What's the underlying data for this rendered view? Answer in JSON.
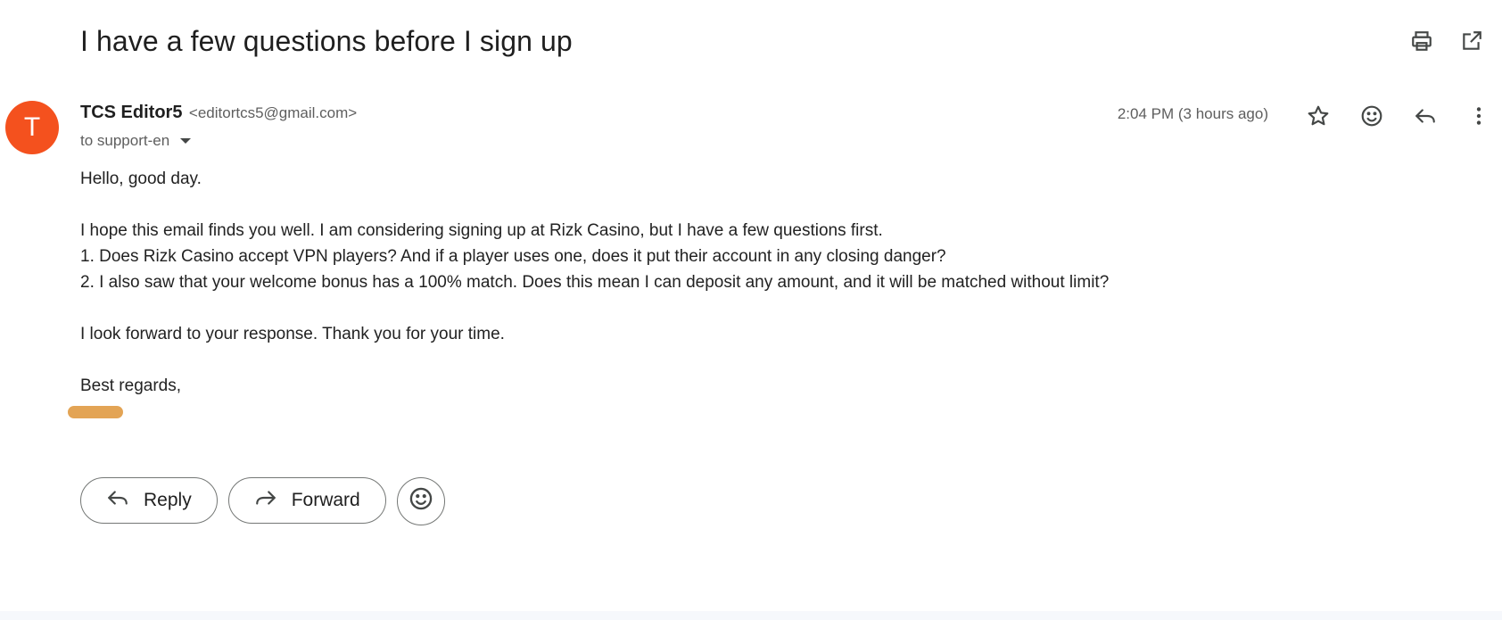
{
  "email": {
    "subject": "I have a few questions before I sign up",
    "sender": {
      "initial": "T",
      "name": "TCS Editor5",
      "email": "<editortcs5@gmail.com>",
      "avatar_color": "#f4511e"
    },
    "recipient": "to support-en",
    "timestamp": "2:04 PM (3 hours ago)",
    "body": {
      "greeting": "Hello, good day.",
      "line1": "I hope this email finds you well. I am considering signing up at Rizk Casino, but I have a few questions first.",
      "line2": "1. Does Rizk Casino accept VPN players? And if a player uses one, does it put their account in any closing danger?",
      "line3": "2. I also saw that your welcome bonus has a 100% match. Does this mean I can deposit any amount, and it will be matched without limit?",
      "line4": "I look forward to your response. Thank you for your time.",
      "closing": "Best regards,",
      "signature_redaction_color": "#e3a455"
    }
  },
  "actions": {
    "reply_label": "Reply",
    "forward_label": "Forward"
  },
  "icons": {
    "top": [
      "print-icon",
      "open-in-new-window-icon"
    ],
    "header": [
      "star-icon",
      "emoji-icon",
      "reply-icon",
      "more-vert-icon"
    ],
    "buttons": [
      "reply-icon",
      "forward-icon",
      "emoji-icon"
    ]
  }
}
